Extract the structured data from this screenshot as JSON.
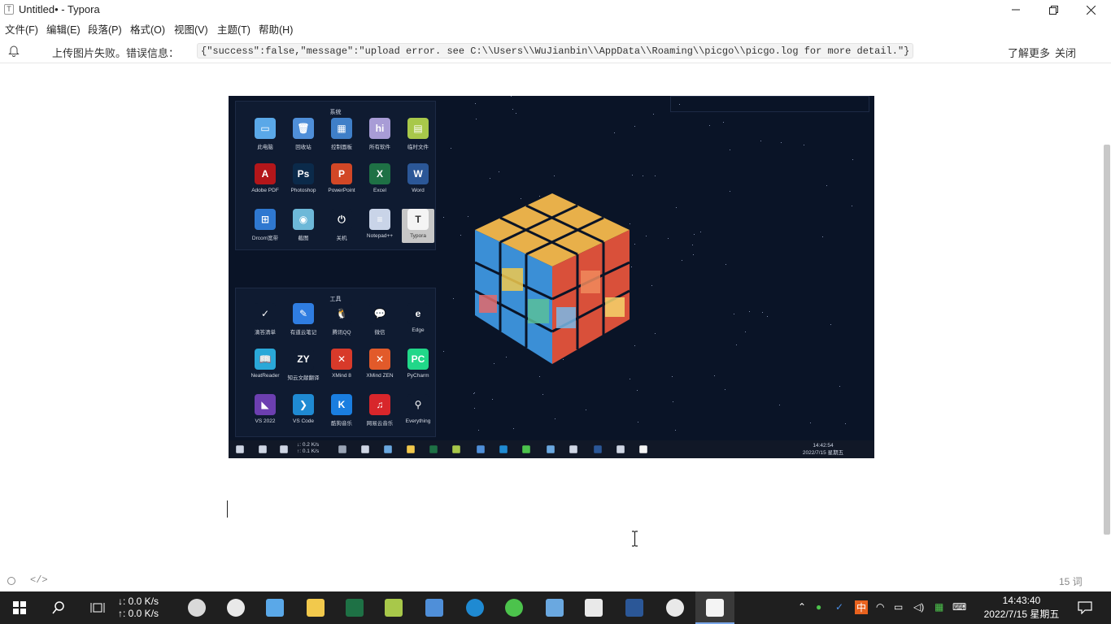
{
  "window": {
    "app_icon": "T",
    "title": "Untitled• - Typora",
    "controls": [
      "minimize-icon",
      "maximize-icon",
      "close-icon"
    ]
  },
  "menu": [
    "文件(F)",
    "编辑(E)",
    "段落(P)",
    "格式(O)",
    "视图(V)",
    "主题(T)",
    "帮助(H)"
  ],
  "notice": {
    "message": "上传图片失败。错误信息：",
    "code": "{\"success\":false,\"message\":\"upload error. see C:\\\\Users\\\\WuJianbin\\\\AppData\\\\Roaming\\\\picgo\\\\picgo.log for more detail.\"}",
    "learn_more": "了解更多",
    "close": "关闭"
  },
  "screenshot": {
    "group1_title": "系统",
    "group1": [
      {
        "label": "此电脑",
        "color": "#5aa8e8",
        "glyph": "▭"
      },
      {
        "label": "回收站",
        "color": "#4f8fd9",
        "glyph": "🗑"
      },
      {
        "label": "控制面板",
        "color": "#3f7fc8",
        "glyph": "▦"
      },
      {
        "label": "所有软件",
        "color": "#a89cd6",
        "glyph": "hi"
      },
      {
        "label": "临时文件",
        "color": "#a8c84a",
        "glyph": "▤"
      },
      {
        "label": "Adobe PDF",
        "color": "#b3161a",
        "glyph": "A"
      },
      {
        "label": "Photoshop",
        "color": "#0b2a4a",
        "glyph": "Ps"
      },
      {
        "label": "PowerPoint",
        "color": "#d24726",
        "glyph": "P"
      },
      {
        "label": "Excel",
        "color": "#1e7145",
        "glyph": "X"
      },
      {
        "label": "Word",
        "color": "#2b5797",
        "glyph": "W"
      },
      {
        "label": "Drcom宽带",
        "color": "#2f78d0",
        "glyph": "⊞"
      },
      {
        "label": "截图",
        "color": "#6db8d8",
        "glyph": "◉"
      },
      {
        "label": "关机",
        "color": "#0f1b31",
        "glyph": "⏻"
      },
      {
        "label": "Notepad++",
        "color": "#c9d4e8",
        "glyph": "≡"
      },
      {
        "label": "Typora",
        "color": "#f4f4f4",
        "glyph": "T"
      }
    ],
    "group2_title": "工具",
    "group2": [
      {
        "label": "滴答清单",
        "color": "#0f1b31",
        "glyph": "✓"
      },
      {
        "label": "有道云笔记",
        "color": "#2f7de1",
        "glyph": "✎"
      },
      {
        "label": "腾讯QQ",
        "color": "#0f1b31",
        "glyph": "🐧"
      },
      {
        "label": "微信",
        "color": "#0f1b31",
        "glyph": "💬"
      },
      {
        "label": "Edge",
        "color": "#0f1b31",
        "glyph": "e"
      },
      {
        "label": "NeatReader",
        "color": "#2aa8d8",
        "glyph": "📖"
      },
      {
        "label": "知云文献翻译",
        "color": "#0f1b31",
        "glyph": "ZY"
      },
      {
        "label": "XMind 8",
        "color": "#d83a2a",
        "glyph": "✕"
      },
      {
        "label": "XMind ZEN",
        "color": "#e25a2a",
        "glyph": "✕"
      },
      {
        "label": "PyCharm",
        "color": "#21d789",
        "glyph": "PC"
      },
      {
        "label": "VS 2022",
        "color": "#6c3fb0",
        "glyph": "◣"
      },
      {
        "label": "VS Code",
        "color": "#1f8ad2",
        "glyph": "❯"
      },
      {
        "label": "酷狗音乐",
        "color": "#1a7ee0",
        "glyph": "K"
      },
      {
        "label": "网易云音乐",
        "color": "#d8262b",
        "glyph": "♫"
      },
      {
        "label": "Everything",
        "color": "#0f1b31",
        "glyph": "⚲"
      }
    ],
    "taskbar": {
      "net_down": "↓: 0.2 K/s",
      "net_up": "↑: 0.1 K/s",
      "time": "14:42:54",
      "date": "2022/7/15 星期五"
    }
  },
  "status": {
    "source_icon": "code-icon",
    "code_label": "</>",
    "word_count": "15 词"
  },
  "taskbar": {
    "net_down": "↓: 0.0 K/s",
    "net_up": "↑: 0.0 K/s",
    "ime": "中",
    "time": "14:43:40",
    "date": "2022/7/15 星期五"
  }
}
